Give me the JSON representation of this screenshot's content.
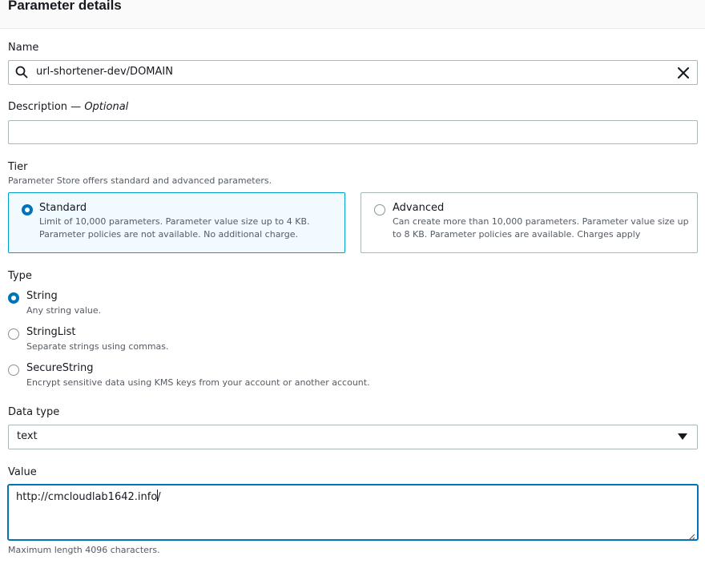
{
  "section": {
    "title": "Parameter details"
  },
  "name": {
    "label": "Name",
    "value": "url-shortener-dev/DOMAIN"
  },
  "description": {
    "label": "Description",
    "optional": "Optional",
    "value": ""
  },
  "tier": {
    "label": "Tier",
    "subtitle": "Parameter Store offers standard and advanced parameters.",
    "options": [
      {
        "title": "Standard",
        "desc1": "Limit of 10,000 parameters. Parameter value size up to 4 KB.",
        "desc2": "Parameter policies are not available. No additional charge.",
        "selected": true
      },
      {
        "title": "Advanced",
        "desc1": "Can create more than 10,000 parameters. Parameter value size up",
        "desc2": "to 8 KB. Parameter policies are available. Charges apply",
        "selected": false
      }
    ]
  },
  "type": {
    "label": "Type",
    "options": [
      {
        "title": "String",
        "desc": "Any string value.",
        "selected": true
      },
      {
        "title": "StringList",
        "desc": "Separate strings using commas.",
        "selected": false
      },
      {
        "title": "SecureString",
        "desc": "Encrypt sensitive data using KMS keys from your account or another account.",
        "selected": false
      }
    ]
  },
  "datatype": {
    "label": "Data type",
    "value": "text"
  },
  "value": {
    "label": "Value",
    "text_before_cursor": "http://cmcloudlab1642.info",
    "text_after_cursor": "/",
    "hint": "Maximum length 4096 characters."
  },
  "colors": {
    "accent": "#0073bb",
    "selected_tile_bg": "#f1faff",
    "selected_tile_border": "#00a1c9",
    "border": "#aab7b8",
    "text": "#16191f",
    "muted": "#545b64"
  }
}
